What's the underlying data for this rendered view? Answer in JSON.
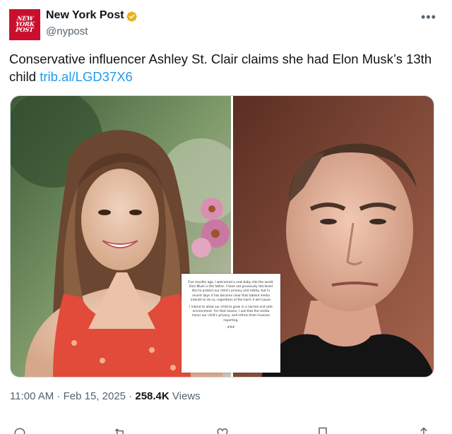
{
  "account": {
    "logo_text": "NEW YORK POST",
    "display_name": "New York Post",
    "handle": "@nypost",
    "verified": true,
    "brand_color": "#c8102e",
    "verified_color": "#e8b21e"
  },
  "tweet": {
    "text": "Conservative influencer Ashley St. Clair claims she had Elon Musk’s 13th child",
    "link": "trib.al/LGD37X6",
    "time": "11:00 AM",
    "date": "Feb 15, 2025",
    "views_count": "258.4K",
    "views_label": "Views"
  },
  "statement": {
    "paragraph1": "Five months ago, I welcomed a new baby into the world. Elon Musk is the father. I have not previously disclosed this to protect our child’s privacy and safety, but in recent days it has become clear that tabloid media intends to do so, regardless of the harm it will cause.",
    "paragraph2": "I intend to allow our child to grow in a normal and safe environment. For that reason, I ask that the media honor our child’s privacy, and refrain from invasive reporting.",
    "sign": "###"
  },
  "icons": {
    "more": "more-icon",
    "reply": "reply-icon",
    "retweet": "retweet-icon",
    "like": "like-icon",
    "bookmark": "bookmark-icon",
    "share": "share-icon"
  },
  "colors": {
    "link": "#1d9bf0",
    "secondary_text": "#536471"
  }
}
